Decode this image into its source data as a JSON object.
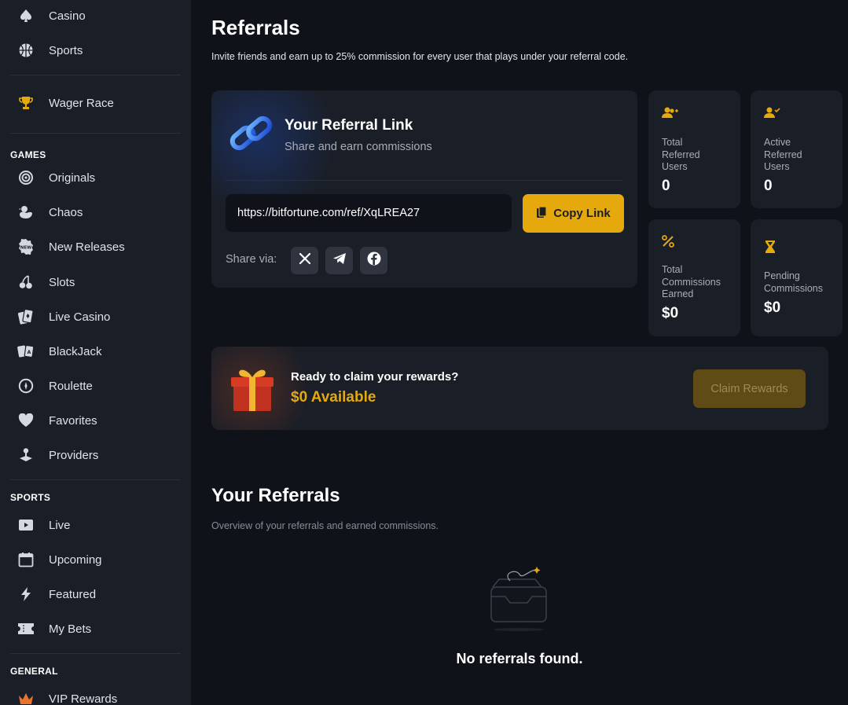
{
  "sidebar": {
    "top_items": [
      {
        "label": "Casino",
        "icon": "spade-icon"
      },
      {
        "label": "Sports",
        "icon": "basketball-icon"
      }
    ],
    "wager_race": {
      "label": "Wager Race",
      "icon": "trophy-icon"
    },
    "games_title": "GAMES",
    "games": [
      {
        "label": "Originals",
        "icon": "target-icon"
      },
      {
        "label": "Chaos",
        "icon": "duck-icon"
      },
      {
        "label": "New Releases",
        "icon": "new-badge-icon"
      },
      {
        "label": "Slots",
        "icon": "cherry-icon"
      },
      {
        "label": "Live Casino",
        "icon": "cards-icon"
      },
      {
        "label": "BlackJack",
        "icon": "blackjack-cards-icon"
      },
      {
        "label": "Roulette",
        "icon": "roulette-icon"
      },
      {
        "label": "Favorites",
        "icon": "heart-icon"
      },
      {
        "label": "Providers",
        "icon": "joystick-icon"
      }
    ],
    "sports_title": "SPORTS",
    "sports": [
      {
        "label": "Live",
        "icon": "play-icon"
      },
      {
        "label": "Upcoming",
        "icon": "calendar-icon"
      },
      {
        "label": "Featured",
        "icon": "lightning-icon"
      },
      {
        "label": "My Bets",
        "icon": "ticket-icon"
      }
    ],
    "general_title": "GENERAL",
    "general": [
      {
        "label": "VIP Rewards",
        "icon": "crown-icon"
      }
    ]
  },
  "page": {
    "title": "Referrals",
    "subtitle": "Invite friends and earn up to 25% commission for every user that plays under your referral code."
  },
  "referral_link": {
    "title": "Your Referral Link",
    "subtitle": "Share and earn commissions",
    "url": "https://bitfortune.com/ref/XqLREA27",
    "copy_label": "Copy Link",
    "share_label": "Share via:"
  },
  "stats": [
    {
      "label_lines": [
        "Total",
        "Referred",
        "Users"
      ],
      "value": "0",
      "icon": "add-user-icon"
    },
    {
      "label_lines": [
        "Active",
        "Referred",
        "Users"
      ],
      "value": "0",
      "icon": "user-check-icon"
    },
    {
      "label_lines": [
        "Total",
        "Commissions",
        "Earned"
      ],
      "value": "$0",
      "icon": "percent-icon"
    },
    {
      "label_lines": [
        "Pending",
        "Commissions"
      ],
      "value": "$0",
      "icon": "hourglass-icon"
    }
  ],
  "claim": {
    "question": "Ready to claim your rewards?",
    "amount": "$0 Available",
    "button": "Claim Rewards"
  },
  "referrals": {
    "title": "Your Referrals",
    "subtitle": "Overview of your referrals and earned commissions.",
    "empty": "No referrals found."
  },
  "colors": {
    "accent": "#e5a90d",
    "background": "#0f1219",
    "card": "#1a1e27"
  }
}
